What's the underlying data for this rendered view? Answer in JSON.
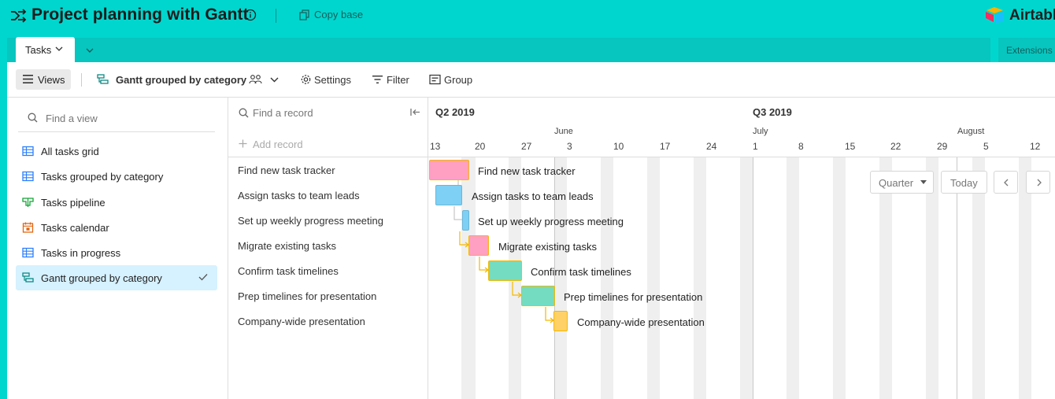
{
  "app": {
    "title": "Project planning with Gantt",
    "copy_label": "Copy base",
    "brand": "Airtable",
    "brand_colors": [
      "#fcb400",
      "#18bfff",
      "#f82b60"
    ],
    "accent": "#00d6ce"
  },
  "tabs": {
    "active_label": "Tasks",
    "extensions_label": "Extensions"
  },
  "viewbar": {
    "views_label": "Views",
    "current_view": "Gantt grouped by category",
    "settings_label": "Settings",
    "filter_label": "Filter",
    "group_label": "Group"
  },
  "sidebar": {
    "search_placeholder": "Find a view",
    "items": [
      {
        "label": "All tasks grid",
        "icon": "grid-icon"
      },
      {
        "label": "Tasks grouped by category",
        "icon": "grid-icon"
      },
      {
        "label": "Tasks pipeline",
        "icon": "kanban-icon"
      },
      {
        "label": "Tasks calendar",
        "icon": "calendar-icon"
      },
      {
        "label": "Tasks in progress",
        "icon": "grid-icon"
      },
      {
        "label": "Gantt grouped by category",
        "icon": "gantt-icon",
        "selected": true
      }
    ]
  },
  "records": {
    "search_placeholder": "Find a record",
    "add_label": "Add record",
    "rows": [
      "Find new task tracker",
      "Assign tasks to team leads",
      "Set up weekly progress meeting",
      "Migrate existing tasks",
      "Confirm task timelines",
      "Prep timelines for presentation",
      "Company-wide presentation"
    ]
  },
  "timeline": {
    "quarters": [
      "Q2 2019",
      "Q3 2019"
    ],
    "months": [
      "June",
      "July",
      "August"
    ],
    "ticks": [
      "13",
      "20",
      "27",
      "3",
      "10",
      "17",
      "24",
      "1",
      "8",
      "15",
      "22",
      "29",
      "5",
      "12"
    ],
    "controls": {
      "zoom_label": "Quarter",
      "today_label": "Today"
    },
    "bars": [
      {
        "label": "Find new task tracker",
        "color": "#ff9fc1"
      },
      {
        "label": "Assign tasks to team leads",
        "color": "#7ed0f5"
      },
      {
        "label": "Set up weekly progress meeting",
        "color": "#7ed0f5"
      },
      {
        "label": "Migrate existing tasks",
        "color": "#ff9fc1"
      },
      {
        "label": "Confirm task timelines",
        "color": "#74dcc0"
      },
      {
        "label": "Prep timelines for presentation",
        "color": "#74dcc0"
      },
      {
        "label": "Company-wide presentation",
        "color": "#ffd166"
      }
    ],
    "dependency_color": "#f5b800"
  }
}
